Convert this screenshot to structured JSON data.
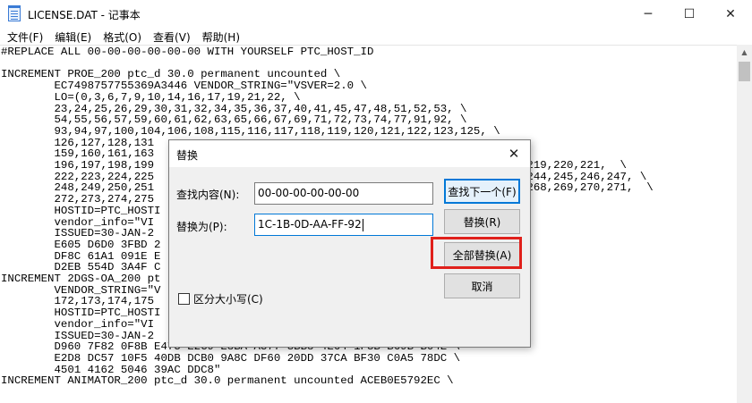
{
  "window": {
    "title": "LICENSE.DAT - 记事本",
    "minimize_glyph": "─",
    "maximize_glyph": "☐",
    "close_glyph": "✕"
  },
  "menu": {
    "items": [
      {
        "label": "文件(F)"
      },
      {
        "label": "编辑(E)"
      },
      {
        "label": "格式(O)"
      },
      {
        "label": "查看(V)"
      },
      {
        "label": "帮助(H)"
      }
    ]
  },
  "editor": {
    "lines": [
      "#REPLACE ALL 00-00-00-00-00-00 WITH YOURSELF PTC_HOST_ID",
      "",
      "INCREMENT PROE_200 ptc_d 30.0 permanent uncounted \\",
      "        EC7498757755369A3446 VENDOR_STRING=\"VSVER=2.0 \\",
      "        LO=(0,3,6,7,9,10,14,16,17,19,21,22, \\",
      "        23,24,25,26,29,30,31,32,34,35,36,37,40,41,45,47,48,51,52,53, \\",
      "        54,55,56,57,59,60,61,62,63,65,66,67,69,71,72,73,74,77,91,92, \\",
      "        93,94,97,100,104,106,108,115,116,117,118,119,120,121,122,123,125, \\",
      "        126,127,128,131",
      "        159,160,161,163",
      "        196,197,198,199                                                  4,218,219,220,221,  \\",
      "        222,223,224,225                                                  2,243,244,245,246,247, \\",
      "        248,249,250,251                                                  6,267,268,269,270,271,  \\",
      "        272,273,274,275",
      "        HOSTID=PTC_HOSTI",
      "        vendor_info=\"VI",
      "        ISSUED=30-JAN-2",
      "        E605 D6D0 3FBD 2",
      "        DF8C 61A1 091E E",
      "        D2EB 554D 3A4F C",
      "INCREMENT 2DGS-OA_200 pt",
      "        VENDOR_STRING=\"V",
      "        172,173,174,175",
      "        HOSTID=PTC_HOSTI",
      "        vendor_info=\"VI",
      "        ISSUED=30-JAN-2",
      "        D960 7F82 0F8B E475 E2C9 E8BA A577 3BB8 4E64 1F3B B69B B04E \\",
      "        E2D8 DC57 10F5 40DB DCB0 9A8C DF60 20DD 37CA BF30 C0A5 78DC \\",
      "        4501 4162 5046 39AC DDC8\"",
      "INCREMENT ANIMATOR_200 ptc_d 30.0 permanent uncounted ACEB0E5792EC \\"
    ]
  },
  "dialog": {
    "title": "替换",
    "close_glyph": "✕",
    "find_label": "查找内容(N):",
    "find_value": "00-00-00-00-00-00",
    "replace_label": "替换为(P):",
    "replace_value": "1C-1B-0D-AA-FF-92",
    "find_next_button": "查找下一个(F)",
    "replace_button": "替换(R)",
    "replace_all_button": "全部替换(A)",
    "cancel_button": "取消",
    "match_case_label": "区分大小写(C)",
    "match_case_checked": false,
    "highlight_color": "#e0201b"
  }
}
